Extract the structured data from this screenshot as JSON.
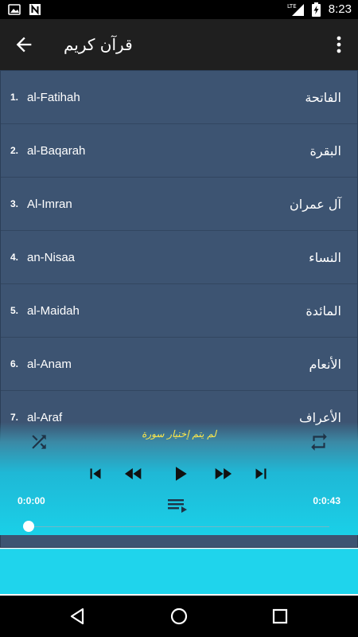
{
  "status_bar": {
    "time": "8:23",
    "icons": [
      "image-icon",
      "nfc-n-icon",
      "lte-signal-icon",
      "battery-charging-icon"
    ],
    "lte_label": "LTE"
  },
  "app_bar": {
    "title": "قرآن كريم",
    "back_icon": "arrow-back-icon",
    "menu_icon": "more-vert-icon"
  },
  "surahs": [
    {
      "num": "1.",
      "latin": "al-Fatihah",
      "arabic": "الفاتحة"
    },
    {
      "num": "2.",
      "latin": "al-Baqarah",
      "arabic": "البقرة"
    },
    {
      "num": "3.",
      "latin": "Al-Imran",
      "arabic": "آل عمران"
    },
    {
      "num": "4.",
      "latin": "an-Nisaa",
      "arabic": "النساء"
    },
    {
      "num": "5.",
      "latin": "al-Maidah",
      "arabic": "المائدة"
    },
    {
      "num": "6.",
      "latin": "al-Anam",
      "arabic": "الأنعام"
    },
    {
      "num": "7.",
      "latin": "al-Araf",
      "arabic": "الأعراف"
    }
  ],
  "player": {
    "status_text": "لم يتم إختيار سورة",
    "time_elapsed": "0:0:00",
    "time_total": "0:0:43",
    "progress": 0,
    "icons": [
      "shuffle-icon",
      "repeat-icon",
      "skip-previous-icon",
      "rewind-icon",
      "play-icon",
      "fast-forward-icon",
      "skip-next-icon",
      "queue-music-icon"
    ]
  },
  "colors": {
    "list_bg": "#3d5472",
    "accent": "#1fd4ec",
    "status_text": "#ffe84a"
  },
  "nav_bar": {
    "icons": [
      "back-triangle-icon",
      "home-circle-icon",
      "recents-square-icon"
    ]
  }
}
